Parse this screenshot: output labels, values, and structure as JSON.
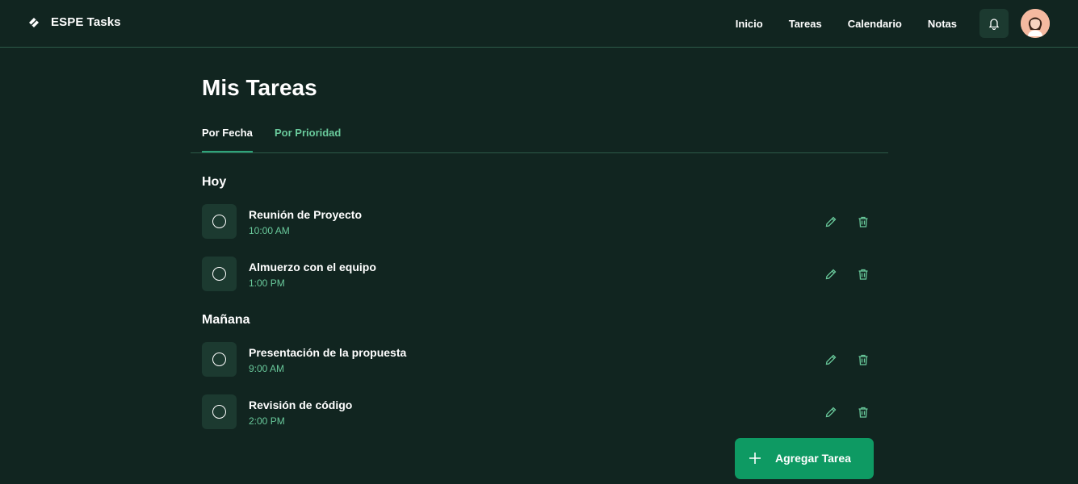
{
  "header": {
    "brand": "ESPE Tasks",
    "nav": [
      "Inicio",
      "Tareas",
      "Calendario",
      "Notas"
    ],
    "notifications_icon": "bell-icon",
    "avatar_icon": "user-avatar"
  },
  "main": {
    "title": "Mis Tareas",
    "tabs": [
      {
        "label": "Por Fecha",
        "active": true
      },
      {
        "label": "Por Prioridad",
        "active": false
      }
    ],
    "sections": [
      {
        "title": "Hoy",
        "tasks": [
          {
            "title": "Reunión de Proyecto",
            "time": "10:00 AM"
          },
          {
            "title": "Almuerzo con el equipo",
            "time": "1:00 PM"
          }
        ]
      },
      {
        "title": "Mañana",
        "tasks": [
          {
            "title": "Presentación de la propuesta",
            "time": "9:00 AM"
          },
          {
            "title": "Revisión de código",
            "time": "2:00 PM"
          }
        ]
      }
    ],
    "add_button": "Agregar Tarea"
  },
  "colors": {
    "background": "#112520",
    "accent": "#0e9a63",
    "muted_green": "#69c99b",
    "card": "#1c3a30"
  }
}
